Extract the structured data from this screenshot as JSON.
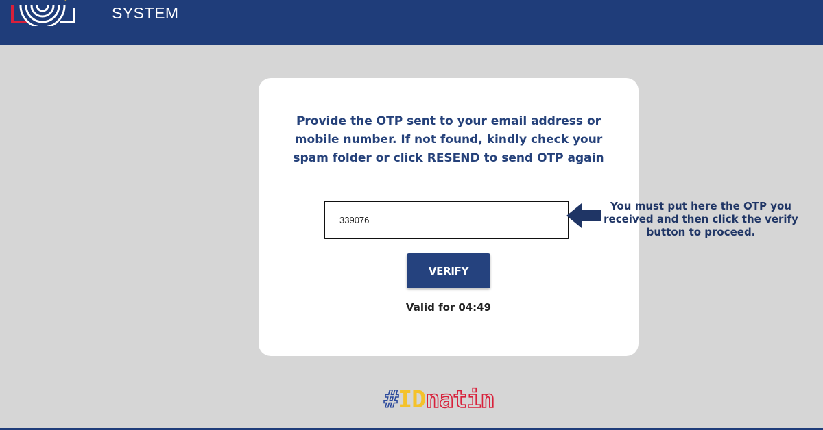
{
  "header": {
    "title": "SYSTEM",
    "background_color": "#1f3d7a",
    "logo_icon": "fingerprint-logo-icon"
  },
  "otp_card": {
    "instructions": "Provide the OTP sent to your email address or mobile number. If not found, kindly check your spam folder or click RESEND to send OTP again",
    "otp_value": "339076",
    "verify_label": "VERIFY",
    "validity_label": "Valid for",
    "validity_timer": "04:49"
  },
  "annotation": {
    "text": "You must put here the OTP you received and then click the verify button to proceed.",
    "arrow_icon": "left-arrow-icon",
    "color": "#1f3565"
  },
  "brand": {
    "hash": "#",
    "id": "ID",
    "natin": "natin",
    "colors": {
      "hash": "#2c4a9c",
      "id": "#f4c22b",
      "natin": "#d8203a"
    }
  },
  "colors": {
    "page_background": "#d6d6d6",
    "card_background": "#ffffff",
    "accent": "#25427e"
  }
}
